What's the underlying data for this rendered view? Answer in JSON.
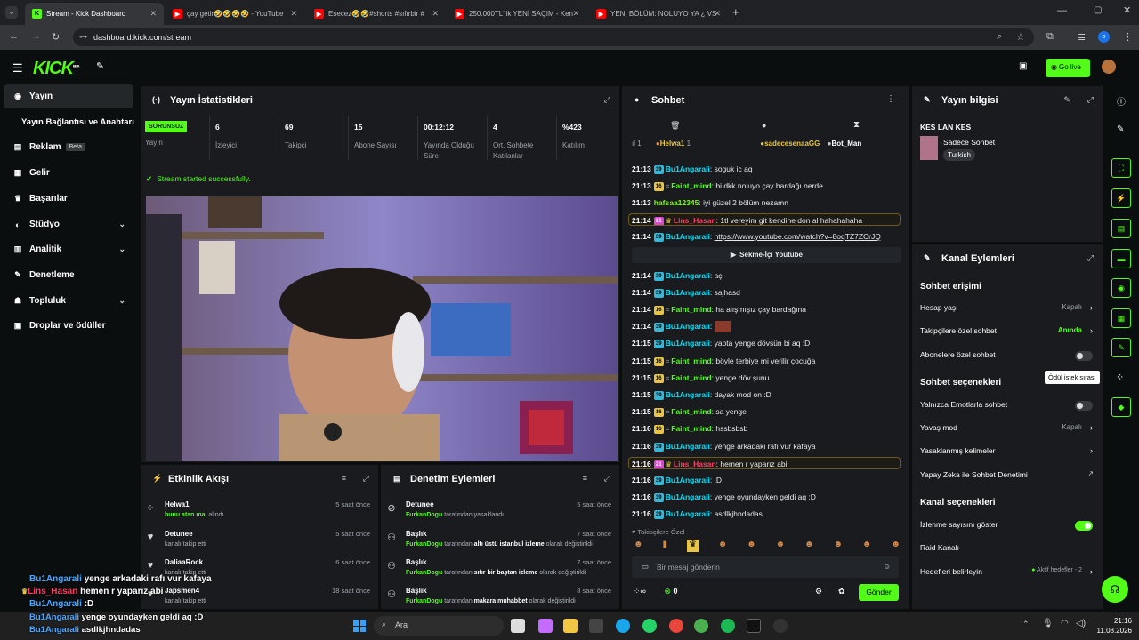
{
  "browser": {
    "tabs": [
      {
        "title": "Stream - Kick Dashboard",
        "active": true
      },
      {
        "title": "çay getir🤣🤣🤣🤣 - YouTube"
      },
      {
        "title": "Esecez🤣🤣#shorts #sıfırbir #"
      },
      {
        "title": "250.000TL'lik YENİ SAÇIM - Ken"
      },
      {
        "title": "YENİ BÖLÜM: NOLUYO YA ¿ VS"
      }
    ],
    "url": "dashboard.kick.com/stream"
  },
  "header": {
    "logo": "KICK",
    "logo_badge": "BETA",
    "go_live": "Go live"
  },
  "sidebar": {
    "items": [
      {
        "label": "Yayın"
      },
      {
        "label": "Yayın Bağlantısı ve Anahtarı"
      },
      {
        "label": "Reklam",
        "badge": "Beta"
      },
      {
        "label": "Gelir"
      },
      {
        "label": "Başarılar"
      },
      {
        "label": "Stüdyo"
      },
      {
        "label": "Analitik"
      },
      {
        "label": "Denetleme"
      },
      {
        "label": "Topluluk"
      },
      {
        "label": "Droplar ve ödüller"
      }
    ]
  },
  "stats": {
    "title": "Yayın İstatistikleri",
    "status": "SORUNSUZ",
    "status_label": "Yayın",
    "items": [
      {
        "value": "6",
        "label": "İzleyici"
      },
      {
        "value": "69",
        "label": "Takipçi"
      },
      {
        "value": "15",
        "label": "Abone Sayısı"
      },
      {
        "value": "00:12:12",
        "label": "Yayında Olduğu Süre"
      },
      {
        "value": "4",
        "label": "Ort. Sohbete Katılanlar"
      },
      {
        "value": "%423",
        "label": "Katılım"
      }
    ],
    "success": "Stream started successfully."
  },
  "activity": {
    "title": "Etkinlik Akışı",
    "rows": [
      {
        "name": "Helwa1",
        "desc": "bunu atan mal",
        "desc2": "alındı",
        "ago": "5 saat önce"
      },
      {
        "name": "Detunee",
        "desc": "kanalı takip etti",
        "ago": "5 saat önce"
      },
      {
        "name": "DaliaaRock",
        "desc": "kanalı takip etti",
        "ago": "6 saat önce"
      },
      {
        "name": "Japsmen4",
        "desc": "kanalı takip etti",
        "ago": "18 saat önce"
      }
    ]
  },
  "moderation": {
    "title": "Denetim Eylemleri",
    "rows": [
      {
        "name": "Detunee",
        "by": "FurkanDogu",
        "rest": "tarafından yasaklandı",
        "ago": "5 saat önce"
      },
      {
        "name": "Başlık",
        "by": "FurkanDogu",
        "rest": "tarafından",
        "quote": "altı üstü istanbul izleme",
        "tail": "olarak değiştirildi",
        "ago": "7 saat önce"
      },
      {
        "name": "Başlık",
        "by": "FurkanDogu",
        "rest": "tarafından",
        "quote": "sıfır bir baştan izleme",
        "tail": "olarak değiştirildi",
        "ago": "7 saat önce"
      },
      {
        "name": "Başlık",
        "by": "FurkanDogu",
        "rest": "tarafından",
        "quote": "makara muhabbet",
        "tail": "olarak değiştirildi",
        "ago": "8 saat önce"
      }
    ]
  },
  "chat": {
    "title": "Sohbet",
    "top_users": [
      "Helwa1",
      "sadecesenaaGG",
      "Bot_Man"
    ],
    "top_counts": [
      "1",
      "1"
    ],
    "messages": [
      {
        "time": "21:13",
        "badge": "39",
        "user": "Bu1Angarali",
        "text": "soguk ic aq",
        "color": "cy"
      },
      {
        "time": "21:13",
        "badge": "16",
        "user": "Faint_mind",
        "text": "bi dkk noluyo çay bardağı nerde",
        "color": "cg"
      },
      {
        "time": "21:13",
        "badge": "",
        "user": "hafsaa12345",
        "text": "iyi güzel 2 bölüm nezamn",
        "color": "cgr"
      },
      {
        "time": "21:14",
        "badge": "21",
        "user": "Lins_Hasan",
        "text": "1tl vereyim git kendine don al hahahahaha",
        "color": "cr",
        "hl": true
      },
      {
        "time": "21:14",
        "badge": "39",
        "user": "Bu1Angarali",
        "text": "https://www.youtube.com/watch?v=8oqTZ7ZCrJQ",
        "color": "cy",
        "link": true
      },
      {
        "time": "21:14",
        "badge": "39",
        "user": "Bu1Angarali",
        "text": "aç",
        "color": "cy"
      },
      {
        "time": "21:14",
        "badge": "39",
        "user": "Bu1Angarali",
        "text": "sajhasd",
        "color": "cy"
      },
      {
        "time": "21:14",
        "badge": "16",
        "user": "Faint_mind",
        "text": "ha alışmışız çay bardağına",
        "color": "cg"
      },
      {
        "time": "21:14",
        "badge": "39",
        "user": "Bu1Angarali",
        "text": "",
        "color": "cy",
        "emote": true
      },
      {
        "time": "21:15",
        "badge": "39",
        "user": "Bu1Angarali",
        "text": "yapta yenge dövsün bi aq :D",
        "color": "cy"
      },
      {
        "time": "21:15",
        "badge": "16",
        "user": "Faint_mind",
        "text": "böyle terbiye mi verilir çocuğa",
        "color": "cg"
      },
      {
        "time": "21:15",
        "badge": "16",
        "user": "Faint_mind",
        "text": "yenge döv şunu",
        "color": "cg"
      },
      {
        "time": "21:15",
        "badge": "39",
        "user": "Bu1Angarali",
        "text": "dayak mod on :D",
        "color": "cy"
      },
      {
        "time": "21:15",
        "badge": "16",
        "user": "Faint_mind",
        "text": "sa yenge",
        "color": "cg"
      },
      {
        "time": "21:16",
        "badge": "16",
        "user": "Faint_mind",
        "text": "hssbsbsb",
        "color": "cg"
      },
      {
        "time": "21:16",
        "badge": "39",
        "user": "Bu1Angarali",
        "text": "yenge arkadaki rafı vur kafaya",
        "color": "cy"
      },
      {
        "time": "21:16",
        "badge": "21",
        "user": "Lins_Hasan",
        "text": "hemen r yaparız abi",
        "color": "cr",
        "hl": true
      },
      {
        "time": "21:16",
        "badge": "39",
        "user": "Bu1Angarali",
        "text": ":D",
        "color": "cy"
      },
      {
        "time": "21:16",
        "badge": "39",
        "user": "Bu1Angarali",
        "text": "yenge oyundayken geldi aq :D",
        "color": "cy"
      },
      {
        "time": "21:16",
        "badge": "39",
        "user": "Bu1Angarali",
        "text": "asdlkjhndadas",
        "color": "cy"
      }
    ],
    "yt_pill": "Sekme-İçi Youtube",
    "followers_label": "Takipçilere Özel",
    "placeholder": "Bir mesaj gönderin",
    "count": "0",
    "send": "Gönder"
  },
  "stream_info": {
    "title": "Yayın bilgisi",
    "stream_title": "KES LAN KES",
    "category": "Sadece Sohbet",
    "tag": "Turkish"
  },
  "channel": {
    "title": "Kanal Eylemleri",
    "chat_access": "Sohbet erişimi",
    "access": [
      {
        "label": "Hesap yaşı",
        "value": "Kapalı"
      },
      {
        "label": "Takipçilere özel sohbet",
        "value": "Anında"
      },
      {
        "label": "Abonelere özel sohbet"
      }
    ],
    "chat_options": "Sohbet seçenekleri",
    "options": [
      {
        "label": "Yalnızca Emotlarla sohbet"
      },
      {
        "label": "Yavaş mod",
        "value": "Kapalı"
      },
      {
        "label": "Yasaklanmış kelimeler"
      },
      {
        "label": "Yapay Zeka ile Sohbet Denetimi"
      }
    ],
    "channel_options": "Kanal seçenekleri",
    "copts": [
      {
        "label": "İzlenme sayısını göster"
      },
      {
        "label": "Raid Kanalı"
      },
      {
        "label": "Hedefleri belirleyin",
        "value": "Aktif hedefler - 2"
      }
    ],
    "tooltip": "Ödül istek sırası"
  },
  "overlay": [
    {
      "user": "Bu1Angarali",
      "text": "yenge arkadaki rafı vur kafaya"
    },
    {
      "user": "Lins_Hasan",
      "text": "hemen r yaparız abi"
    },
    {
      "user": "Bu1Angarali",
      "text": ":D"
    },
    {
      "user": "Bu1Angarali",
      "text": "yenge oyundayken geldi aq :D"
    },
    {
      "user": "Bu1Angarali",
      "text": "asdlkjhndadas"
    }
  ],
  "taskbar": {
    "search": "Ara",
    "time": "21:16",
    "date": "11.08.2026"
  }
}
